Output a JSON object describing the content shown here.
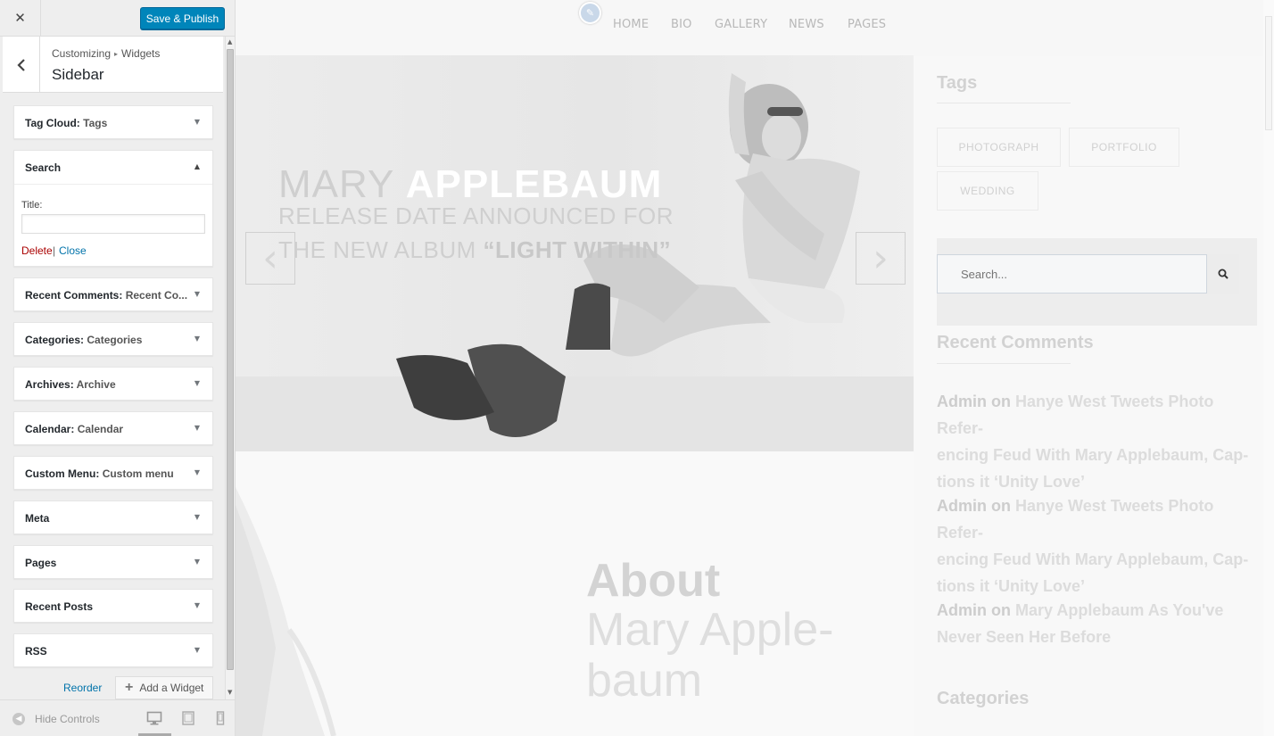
{
  "topbar": {
    "close_glyph": "✕",
    "save_label": "Save & Publish"
  },
  "section": {
    "breadcrumb_root": "Customizing",
    "breadcrumb_child": "Widgets",
    "title": "Sidebar"
  },
  "widgets": [
    {
      "name": "Tag Cloud",
      "sep": ": ",
      "subtitle": "Tags",
      "expanded": false
    },
    {
      "name": "Search",
      "sep": "",
      "subtitle": "",
      "expanded": true
    },
    {
      "name": "Recent Comments",
      "sep": ": ",
      "subtitle": "Recent Co...",
      "expanded": false
    },
    {
      "name": "Categories",
      "sep": ": ",
      "subtitle": "Categories",
      "expanded": false
    },
    {
      "name": "Archives",
      "sep": ": ",
      "subtitle": "Archive",
      "expanded": false
    },
    {
      "name": "Calendar",
      "sep": ": ",
      "subtitle": "Calendar",
      "expanded": false
    },
    {
      "name": "Custom Menu",
      "sep": ": ",
      "subtitle": "Custom menu",
      "expanded": false
    },
    {
      "name": "Meta",
      "sep": "",
      "subtitle": "",
      "expanded": false
    },
    {
      "name": "Pages",
      "sep": "",
      "subtitle": "",
      "expanded": false
    },
    {
      "name": "Recent Posts",
      "sep": "",
      "subtitle": "",
      "expanded": false
    },
    {
      "name": "RSS",
      "sep": "",
      "subtitle": "",
      "expanded": false
    }
  ],
  "search_widget": {
    "title_label": "Title:",
    "title_value": "",
    "delete_label": "Delete",
    "pipe": "|",
    "close_label": "Close"
  },
  "actions": {
    "reorder_label": "Reorder",
    "add_widget_label": "Add a Widget",
    "add_glyph": "+"
  },
  "footer": {
    "hide_controls_label": "Hide Controls",
    "devices": [
      "desktop-icon",
      "tablet-icon",
      "mobile-icon"
    ],
    "active_device": "desktop"
  },
  "preview": {
    "nav": [
      "HOME",
      "BIO",
      "GALLERY",
      "NEWS",
      "PAGES"
    ],
    "hero": {
      "name_light": "MARY ",
      "name_bold": "APPLEBAUM",
      "line2": "RELEASE DATE ANNOUNCED FOR",
      "line3_light": "THE NEW ALBUM ",
      "line3_bold": "“LIGHT WITHIN”",
      "prev_glyph": "‹",
      "next_glyph": "›"
    },
    "about": {
      "title": "About",
      "name_line1": "Mary Apple-",
      "name_line2": "baum"
    },
    "sidebar": {
      "tags_heading": "Tags",
      "tags": [
        "PHOTOGRAPH",
        "PORTFOLIO",
        "WEDDING"
      ],
      "search_placeholder": "Search...",
      "recent_comments_heading": "Recent Comments",
      "comments": [
        {
          "author": "Admin",
          "on": " on ",
          "line1": "Hanye West Tweets Photo Refer-",
          "line2": "encing Feud With Mary Applebaum, Cap-",
          "line3": "tions it ‘Unity Love’"
        },
        {
          "author": "Admin",
          "on": " on ",
          "line1": "Hanye West Tweets Photo Refer-",
          "line2": "encing Feud With Mary Applebaum, Cap-",
          "line3": "tions it ‘Unity Love’"
        },
        {
          "author": "Admin",
          "on": " on ",
          "line1": "Mary Applebaum As You've",
          "line2": "Never Seen Her Before",
          "line3": ""
        }
      ],
      "categories_heading": "Categories"
    }
  },
  "colors": {
    "primary_button": "#0085ba",
    "link": "#0073aa",
    "delete": "#aa0000"
  }
}
